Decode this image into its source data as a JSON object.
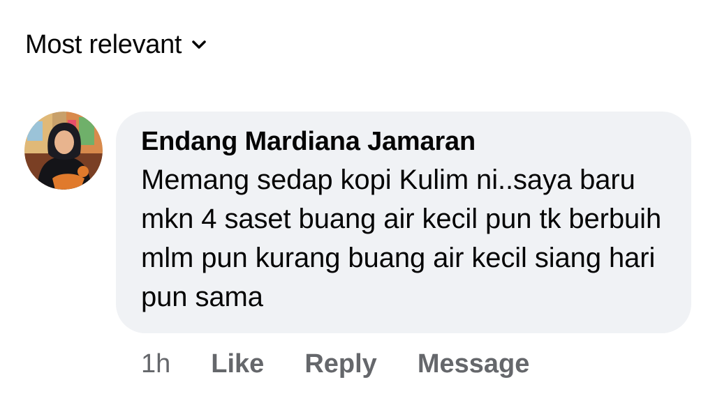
{
  "sort": {
    "label": "Most relevant",
    "icon": "chevron-down-icon"
  },
  "comment": {
    "author": "Endang Mardiana Jamaran",
    "text": "Memang sedap kopi Kulim ni..saya baru mkn 4 saset buang air kecil pun tk berbuih mlm pun kurang buang air kecil siang hari pun sama",
    "timestamp": "1h",
    "actions": {
      "like": "Like",
      "reply": "Reply",
      "message": "Message"
    }
  },
  "colors": {
    "bubble_bg": "#f0f2f5",
    "primary_text": "#050505",
    "secondary_text": "#65676b"
  }
}
